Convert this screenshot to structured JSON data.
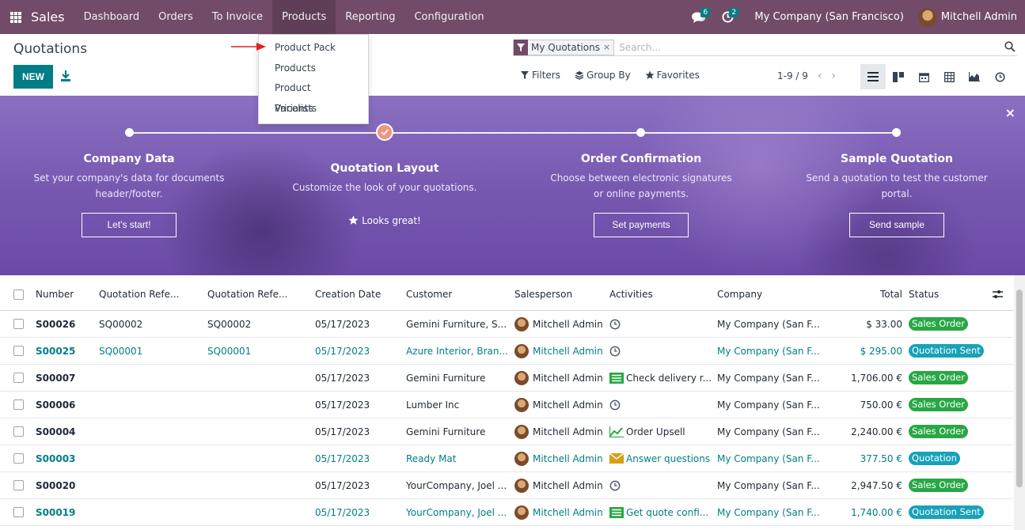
{
  "navbar": {
    "brand": "Sales",
    "menu": [
      "Dashboard",
      "Orders",
      "To Invoice",
      "Products",
      "Reporting",
      "Configuration"
    ],
    "chat_count": "6",
    "activity_count": "2",
    "company": "My Company (San Francisco)",
    "user": "Mitchell Admin"
  },
  "products_menu": [
    "Product Pack",
    "Products",
    "Product Variants",
    "Pricelists"
  ],
  "control": {
    "title": "Quotations",
    "new_label": "NEW",
    "facet_label": "My Quotations",
    "facet_close": "×",
    "search_placeholder": "Search...",
    "filters": "Filters",
    "group_by": "Group By",
    "favorites": "Favorites",
    "pager": "1-9 / 9",
    "pager_prev": "‹",
    "pager_next": "›"
  },
  "onboarding": {
    "close": "×",
    "steps": [
      {
        "title": "Company Data",
        "desc1": "Set your company's data for documents",
        "desc2": "header/footer.",
        "button": "Let's start!"
      },
      {
        "title": "Quotation Layout",
        "desc1": "Customize the look of your quotations.",
        "desc2": "",
        "done": "Looks great!"
      },
      {
        "title": "Order Confirmation",
        "desc1": "Choose between electronic signatures",
        "desc2": "or online payments.",
        "button": "Set payments"
      },
      {
        "title": "Sample Quotation",
        "desc1": "Send a quotation to test the customer",
        "desc2": "portal.",
        "button": "Send sample"
      }
    ]
  },
  "table": {
    "headers": [
      "Number",
      "Quotation Refe...",
      "Quotation Refe...",
      "Creation Date",
      "Customer",
      "Salesperson",
      "Activities",
      "Company",
      "Total",
      "Status"
    ],
    "rows": [
      {
        "number": "S00026",
        "ref1": "SQ00002",
        "ref2": "SQ00002",
        "date": "05/17/2023",
        "customer": "Gemini Furniture, S...",
        "salesperson": "Mitchell Admin",
        "activity": "",
        "activity_icon": "clock-icon",
        "company": "My Company (San F...",
        "total": "$ 33.00",
        "status": "Sales Order",
        "status_type": "so",
        "highlight": false
      },
      {
        "number": "S00025",
        "ref1": "SQ00001",
        "ref2": "SQ00001",
        "date": "05/17/2023",
        "customer": "Azure Interior, Bran...",
        "salesperson": "Mitchell Admin",
        "activity": "",
        "activity_icon": "clock-icon",
        "company": "My Company (San F...",
        "total": "$ 295.00",
        "status": "Quotation Sent",
        "status_type": "qs",
        "highlight": true
      },
      {
        "number": "S00007",
        "ref1": "",
        "ref2": "",
        "date": "05/17/2023",
        "customer": "Gemini Furniture",
        "salesperson": "Mitchell Admin",
        "activity": "Check delivery r...",
        "activity_icon": "list-icon",
        "company": "My Company (San F...",
        "total": "1,706.00 €",
        "status": "Sales Order",
        "status_type": "so",
        "highlight": false
      },
      {
        "number": "S00006",
        "ref1": "",
        "ref2": "",
        "date": "05/17/2023",
        "customer": "Lumber Inc",
        "salesperson": "Mitchell Admin",
        "activity": "",
        "activity_icon": "clock-icon",
        "company": "My Company (San F...",
        "total": "750.00 €",
        "status": "Sales Order",
        "status_type": "so",
        "highlight": false
      },
      {
        "number": "S00004",
        "ref1": "",
        "ref2": "",
        "date": "05/17/2023",
        "customer": "Gemini Furniture",
        "salesperson": "Mitchell Admin",
        "activity": "Order Upsell",
        "activity_icon": "trend-icon",
        "company": "My Company (San F...",
        "total": "2,240.00 €",
        "status": "Sales Order",
        "status_type": "so",
        "highlight": false
      },
      {
        "number": "S00003",
        "ref1": "",
        "ref2": "",
        "date": "05/17/2023",
        "customer": "Ready Mat",
        "salesperson": "Mitchell Admin",
        "activity": "Answer questions",
        "activity_icon": "envelope-icon",
        "company": "My Company (San F...",
        "total": "377.50 €",
        "status": "Quotation",
        "status_type": "q",
        "highlight": true
      },
      {
        "number": "S00020",
        "ref1": "",
        "ref2": "",
        "date": "05/17/2023",
        "customer": "YourCompany, Joel ...",
        "salesperson": "Mitchell Admin",
        "activity": "",
        "activity_icon": "clock-icon",
        "company": "My Company (San F...",
        "total": "2,947.50 €",
        "status": "Sales Order",
        "status_type": "so",
        "highlight": false
      },
      {
        "number": "S00019",
        "ref1": "",
        "ref2": "",
        "date": "05/17/2023",
        "customer": "YourCompany, Joel ...",
        "salesperson": "Mitchell Admin",
        "activity": "Get quote confi...",
        "activity_icon": "list-icon",
        "company": "My Company (San F...",
        "total": "1,740.00 €",
        "status": "Quotation Sent",
        "status_type": "qs",
        "highlight": true
      }
    ]
  },
  "colors": {
    "brand": "#714b67",
    "accent": "#017e84",
    "sales_order": "#28a745",
    "quotation_sent": "#17a2b8"
  }
}
